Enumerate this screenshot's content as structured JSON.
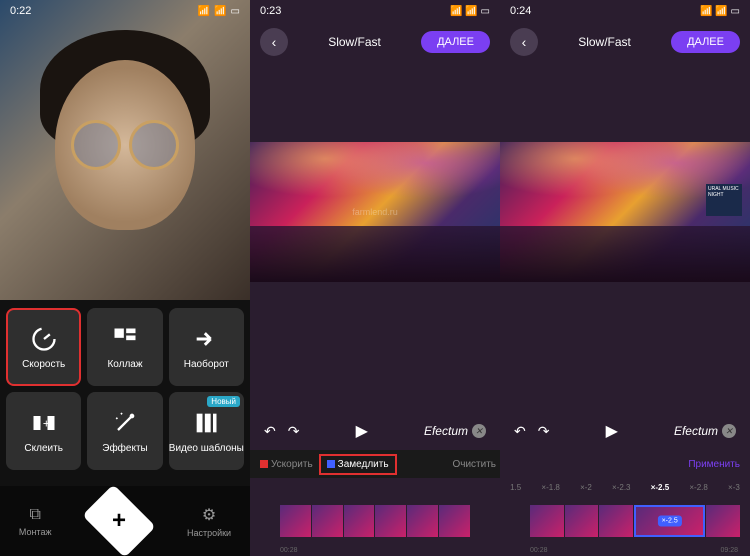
{
  "phone1": {
    "status_time": "0:22",
    "tiles": [
      {
        "name": "speed",
        "label": "Скорость",
        "highlight": true
      },
      {
        "name": "collage",
        "label": "Коллаж",
        "highlight": false
      },
      {
        "name": "reverse",
        "label": "Наоборот",
        "highlight": false
      },
      {
        "name": "merge",
        "label": "Склеить",
        "highlight": false
      },
      {
        "name": "effects",
        "label": "Эффекты",
        "highlight": false
      },
      {
        "name": "templates",
        "label": "Видео шаблоны",
        "highlight": false,
        "badge": "Новый"
      }
    ],
    "bottom": {
      "montage": "Монтаж",
      "settings": "Настройки"
    }
  },
  "phone2": {
    "status_time": "0:23",
    "title": "Slow/Fast",
    "next": "ДАЛЕЕ",
    "watermark": "farmlend.ru",
    "brand": "Efectum",
    "tabs": {
      "speedup": "Ускорить",
      "slowdown": "Замедлить",
      "clear": "Очистить"
    },
    "timeline": {
      "start": "00:28"
    }
  },
  "phone3": {
    "status_time": "0:24",
    "title": "Slow/Fast",
    "next": "ДАЛЕЕ",
    "brand": "Efectum",
    "sign": "URAL MUSIC NIGHT",
    "apply": "Применить",
    "speeds": [
      "1.5",
      "×-1.8",
      "×-2",
      "×-2.3",
      "×-2.5",
      "×-2.8",
      "×-3"
    ],
    "active_speed": "×-2.5",
    "timeline": {
      "start": "00:28",
      "end": "09:28"
    }
  }
}
